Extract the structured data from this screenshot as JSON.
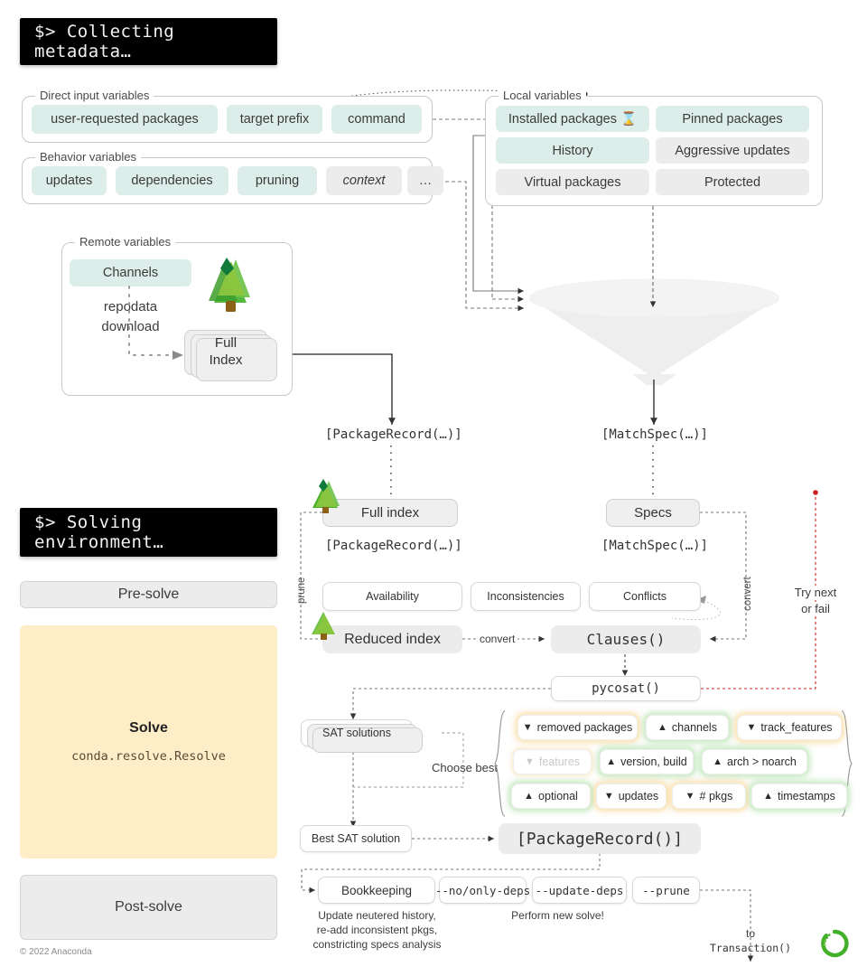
{
  "meta": {
    "copyright": "© 2022 Anaconda",
    "accent_mint": "#ddeeea",
    "accent_cream": "#fdeec8",
    "accent_green": "#43b02a",
    "accent_orange": "#f0b429",
    "accent_red": "#cc2222"
  },
  "banners": {
    "collecting": "$> Collecting metadata…",
    "solving": "$> Solving environment…"
  },
  "groups": {
    "direct_input": {
      "label": "Direct input variables",
      "items": [
        {
          "label": "user-requested packages",
          "style": "mint"
        },
        {
          "label": "target prefix",
          "style": "mint"
        },
        {
          "label": "command",
          "style": "mint"
        }
      ]
    },
    "behavior": {
      "label": "Behavior variables",
      "items": [
        {
          "label": "updates",
          "style": "mint"
        },
        {
          "label": "dependencies",
          "style": "mint"
        },
        {
          "label": "pruning",
          "style": "mint"
        },
        {
          "label": "context",
          "style": "grey-italic"
        },
        {
          "label": "…",
          "style": "grey"
        }
      ]
    },
    "local": {
      "label": "Local variables",
      "items": [
        {
          "label": "Installed packages ⌛",
          "style": "mint"
        },
        {
          "label": "Pinned packages",
          "style": "mint"
        },
        {
          "label": "History",
          "style": "mint"
        },
        {
          "label": "Aggressive updates",
          "style": "grey"
        },
        {
          "label": "Virtual packages",
          "style": "grey"
        },
        {
          "label": "Protected",
          "style": "grey"
        }
      ]
    },
    "remote": {
      "label": "Remote variables",
      "channels": "Channels",
      "repodata_line1": "repodata",
      "repodata_line2": "download",
      "full_index_line1": "Full",
      "full_index_line2": "Index"
    }
  },
  "flow": {
    "package_record_list": "[PackageRecord(…)]",
    "match_spec_list": "[MatchSpec(…)]",
    "full_index": "Full index",
    "specs": "Specs",
    "package_record_list2": "[PackageRecord(…)]",
    "match_spec_list2": "[MatchSpec(…)]",
    "availability": "Availability",
    "inconsistencies": "Inconsistencies",
    "conflicts": "Conflicts",
    "reduced_index": "Reduced index",
    "clauses": "Clauses()",
    "pycosat": "pycosat()",
    "sat_solutions": "SAT solutions",
    "best_sat_solution": "Best SAT solution",
    "package_record_result": "[PackageRecord()]",
    "label_prune": "prune",
    "label_convert_side": "convert",
    "label_convert_mid": "convert",
    "label_choose_best": "Choose best",
    "label_try_next_1": "Try next",
    "label_try_next_2": "or fail"
  },
  "rail": {
    "pre_solve": "Pre-solve",
    "solve_title": "Solve",
    "solve_module": "conda.resolve.Resolve",
    "post_solve": "Post-solve"
  },
  "criteria": {
    "rows": [
      [
        {
          "label": "removed packages",
          "direction": "down",
          "state": "on"
        },
        {
          "label": "channels",
          "direction": "up",
          "state": "on"
        },
        {
          "label": "track_features",
          "direction": "down",
          "state": "on"
        }
      ],
      [
        {
          "label": "features",
          "direction": "down",
          "state": "off"
        },
        {
          "label": "version, build",
          "direction": "up",
          "state": "on"
        },
        {
          "label": "arch > noarch",
          "direction": "up",
          "state": "on"
        }
      ],
      [
        {
          "label": "optional",
          "direction": "up",
          "state": "on"
        },
        {
          "label": "updates",
          "direction": "down",
          "state": "on"
        },
        {
          "label": "# pkgs",
          "direction": "down",
          "state": "on"
        },
        {
          "label": "timestamps",
          "direction": "up",
          "state": "on"
        }
      ]
    ]
  },
  "postsolve": {
    "bookkeeping": "Bookkeeping",
    "flags": [
      "--no/only-deps",
      "--update-deps",
      "--prune"
    ],
    "bookkeeping_note_1": "Update neutered history,",
    "bookkeeping_note_2": "re-add inconsistent pkgs,",
    "bookkeeping_note_3": "constricting specs analysis",
    "perform_new_solve": "Perform new solve!",
    "to_label": "to",
    "transaction_label": "Transaction()"
  }
}
